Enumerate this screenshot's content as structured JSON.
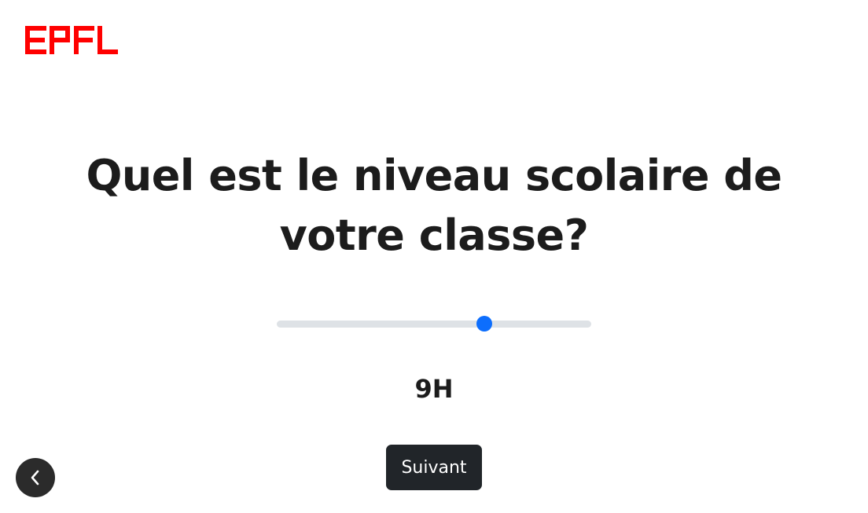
{
  "logo": {
    "text": "EPFL",
    "color": "#ff0000"
  },
  "question": {
    "text": "Quel est le niveau scolaire de votre classe?"
  },
  "slider": {
    "value_fraction": 0.66,
    "track_color": "#dee2e6",
    "thumb_color": "#0d6efd"
  },
  "selected_value": "9H",
  "buttons": {
    "next_label": "Suivant",
    "back_icon": "chevron-left-icon"
  }
}
